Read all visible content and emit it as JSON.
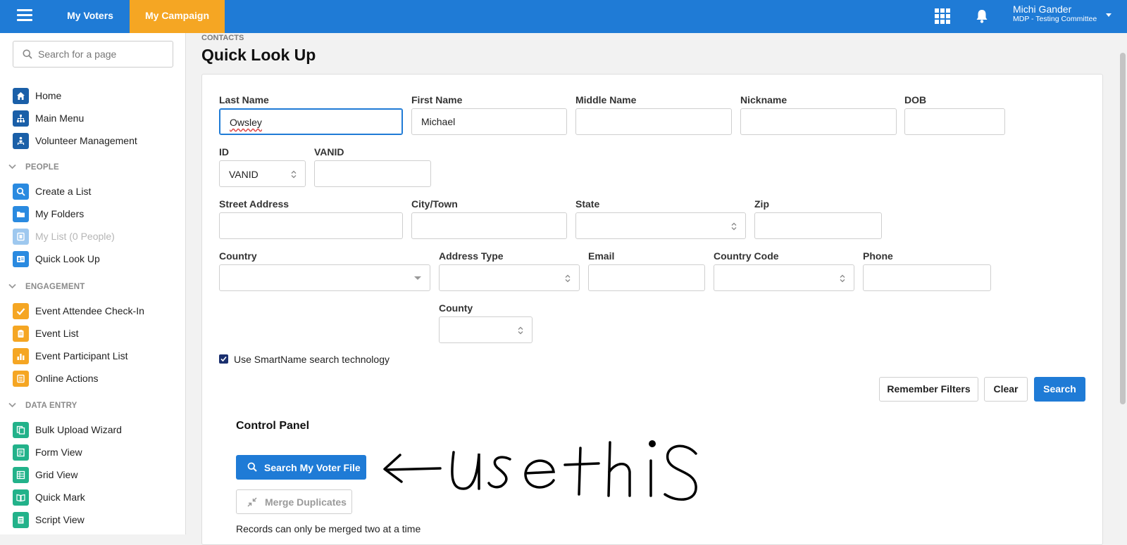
{
  "topbar": {
    "menu_icon": "hamburger-icon",
    "tabs": [
      {
        "label": "My Voters",
        "active": false
      },
      {
        "label": "My Campaign",
        "active": true
      }
    ],
    "apps_icon": "grid-icon",
    "notifications_icon": "bell-icon",
    "user": {
      "name": "Michi Gander",
      "org": "MDP - Testing Committee"
    },
    "brand_color": "#1f7bd6",
    "active_tab_color": "#f5a623"
  },
  "sidebar": {
    "search_placeholder": "Search for a page",
    "items": [
      {
        "label": "Home",
        "icon": "home-icon"
      },
      {
        "label": "Main Menu",
        "icon": "sitemap-icon"
      },
      {
        "label": "Volunteer Management",
        "icon": "org-chart-icon"
      }
    ],
    "sections": [
      {
        "title": "PEOPLE",
        "items": [
          {
            "label": "Create a List",
            "icon": "search-icon"
          },
          {
            "label": "My Folders",
            "icon": "folder-icon"
          },
          {
            "label": "My List (0 People)",
            "icon": "list-icon",
            "disabled": true
          },
          {
            "label": "Quick Look Up",
            "icon": "id-card-icon"
          }
        ]
      },
      {
        "title": "ENGAGEMENT",
        "items": [
          {
            "label": "Event Attendee Check-In",
            "icon": "checkmark-icon"
          },
          {
            "label": "Event List",
            "icon": "clipboard-icon"
          },
          {
            "label": "Event Participant List",
            "icon": "bar-chart-icon"
          },
          {
            "label": "Online Actions",
            "icon": "form-icon"
          }
        ]
      },
      {
        "title": "DATA ENTRY",
        "items": [
          {
            "label": "Bulk Upload Wizard",
            "icon": "upload-icon"
          },
          {
            "label": "Form View",
            "icon": "form-view-icon"
          },
          {
            "label": "Grid View",
            "icon": "grid-view-icon"
          },
          {
            "label": "Quick Mark",
            "icon": "book-icon"
          },
          {
            "label": "Script View",
            "icon": "script-icon"
          }
        ]
      }
    ]
  },
  "page": {
    "breadcrumb": "CONTACTS",
    "title": "Quick Look Up"
  },
  "form": {
    "last_name": {
      "label": "Last Name",
      "value": "Owsley"
    },
    "first_name": {
      "label": "First Name",
      "value": "Michael"
    },
    "middle_name": {
      "label": "Middle Name",
      "value": ""
    },
    "nickname": {
      "label": "Nickname",
      "value": ""
    },
    "dob": {
      "label": "DOB",
      "value": ""
    },
    "id_type": {
      "label": "ID",
      "value": "VANID"
    },
    "vanid": {
      "label": "VANID",
      "value": ""
    },
    "street_address": {
      "label": "Street Address",
      "value": ""
    },
    "city": {
      "label": "City/Town",
      "value": ""
    },
    "state": {
      "label": "State",
      "value": ""
    },
    "zip": {
      "label": "Zip",
      "value": ""
    },
    "country": {
      "label": "Country",
      "value": ""
    },
    "address_type": {
      "label": "Address Type",
      "value": ""
    },
    "email": {
      "label": "Email",
      "value": ""
    },
    "country_code": {
      "label": "Country Code",
      "value": ""
    },
    "phone": {
      "label": "Phone",
      "value": ""
    },
    "county": {
      "label": "County",
      "value": ""
    },
    "smartname": {
      "label": "Use SmartName search technology",
      "checked": true
    }
  },
  "actions": {
    "remember_filters": "Remember Filters",
    "clear": "Clear",
    "search": "Search"
  },
  "control_panel": {
    "title": "Control Panel",
    "search_voter_file": "Search My Voter File",
    "merge_duplicates": "Merge Duplicates",
    "merge_note": "Records can only be merged two at a time"
  },
  "annotation": {
    "text": "usethis"
  }
}
